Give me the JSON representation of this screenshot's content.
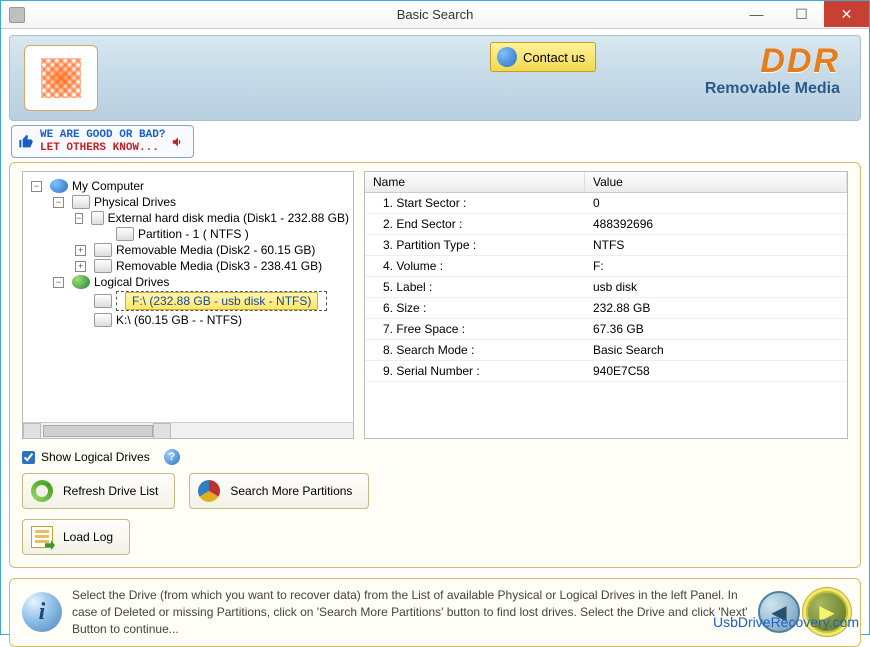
{
  "window": {
    "title": "Basic Search"
  },
  "banner": {
    "contact_label": "Contact us",
    "brand": "DDR",
    "subtitle": "Removable Media"
  },
  "feedback": {
    "line1": "WE ARE GOOD OR BAD?",
    "line2": "LET OTHERS KNOW..."
  },
  "tree": {
    "root": "My Computer",
    "physical_label": "Physical Drives",
    "logical_label": "Logical Drives",
    "physical": [
      {
        "label": "External hard disk media (Disk1 - 232.88 GB)",
        "expanded": true,
        "children": [
          "Partition - 1 ( NTFS )"
        ]
      },
      {
        "label": "Removable Media (Disk2 - 60.15 GB)",
        "expanded": false,
        "children": []
      },
      {
        "label": "Removable Media (Disk3 - 238.41 GB)",
        "expanded": false,
        "children": []
      }
    ],
    "logical": [
      {
        "label": "F:\\ (232.88 GB - usb disk - NTFS)",
        "selected": true
      },
      {
        "label": "K:\\ (60.15 GB -  - NTFS)",
        "selected": false
      }
    ]
  },
  "grid": {
    "headers": {
      "name": "Name",
      "value": "Value"
    },
    "rows": [
      {
        "name": "1. Start Sector :",
        "value": "0"
      },
      {
        "name": "2. End Sector :",
        "value": "488392696"
      },
      {
        "name": "3. Partition Type :",
        "value": "NTFS"
      },
      {
        "name": "4. Volume :",
        "value": "F:"
      },
      {
        "name": "5. Label :",
        "value": "usb disk"
      },
      {
        "name": "6. Size :",
        "value": "232.88 GB"
      },
      {
        "name": "7. Free Space :",
        "value": "67.36 GB"
      },
      {
        "name": "8. Search Mode :",
        "value": "Basic Search"
      },
      {
        "name": "9. Serial Number :",
        "value": "940E7C58"
      }
    ]
  },
  "controls": {
    "show_logical": "Show Logical Drives",
    "refresh": "Refresh Drive List",
    "search_more": "Search More Partitions",
    "load_log": "Load Log"
  },
  "hint": "Select the Drive (from which you want to recover data) from the List of available Physical or Logical Drives in the left Panel. In case of Deleted or missing Partitions, click on 'Search More Partitions' button to find lost drives. Select the Drive and click 'Next' Button to continue...",
  "website": "UsbDriveRecovery.com"
}
